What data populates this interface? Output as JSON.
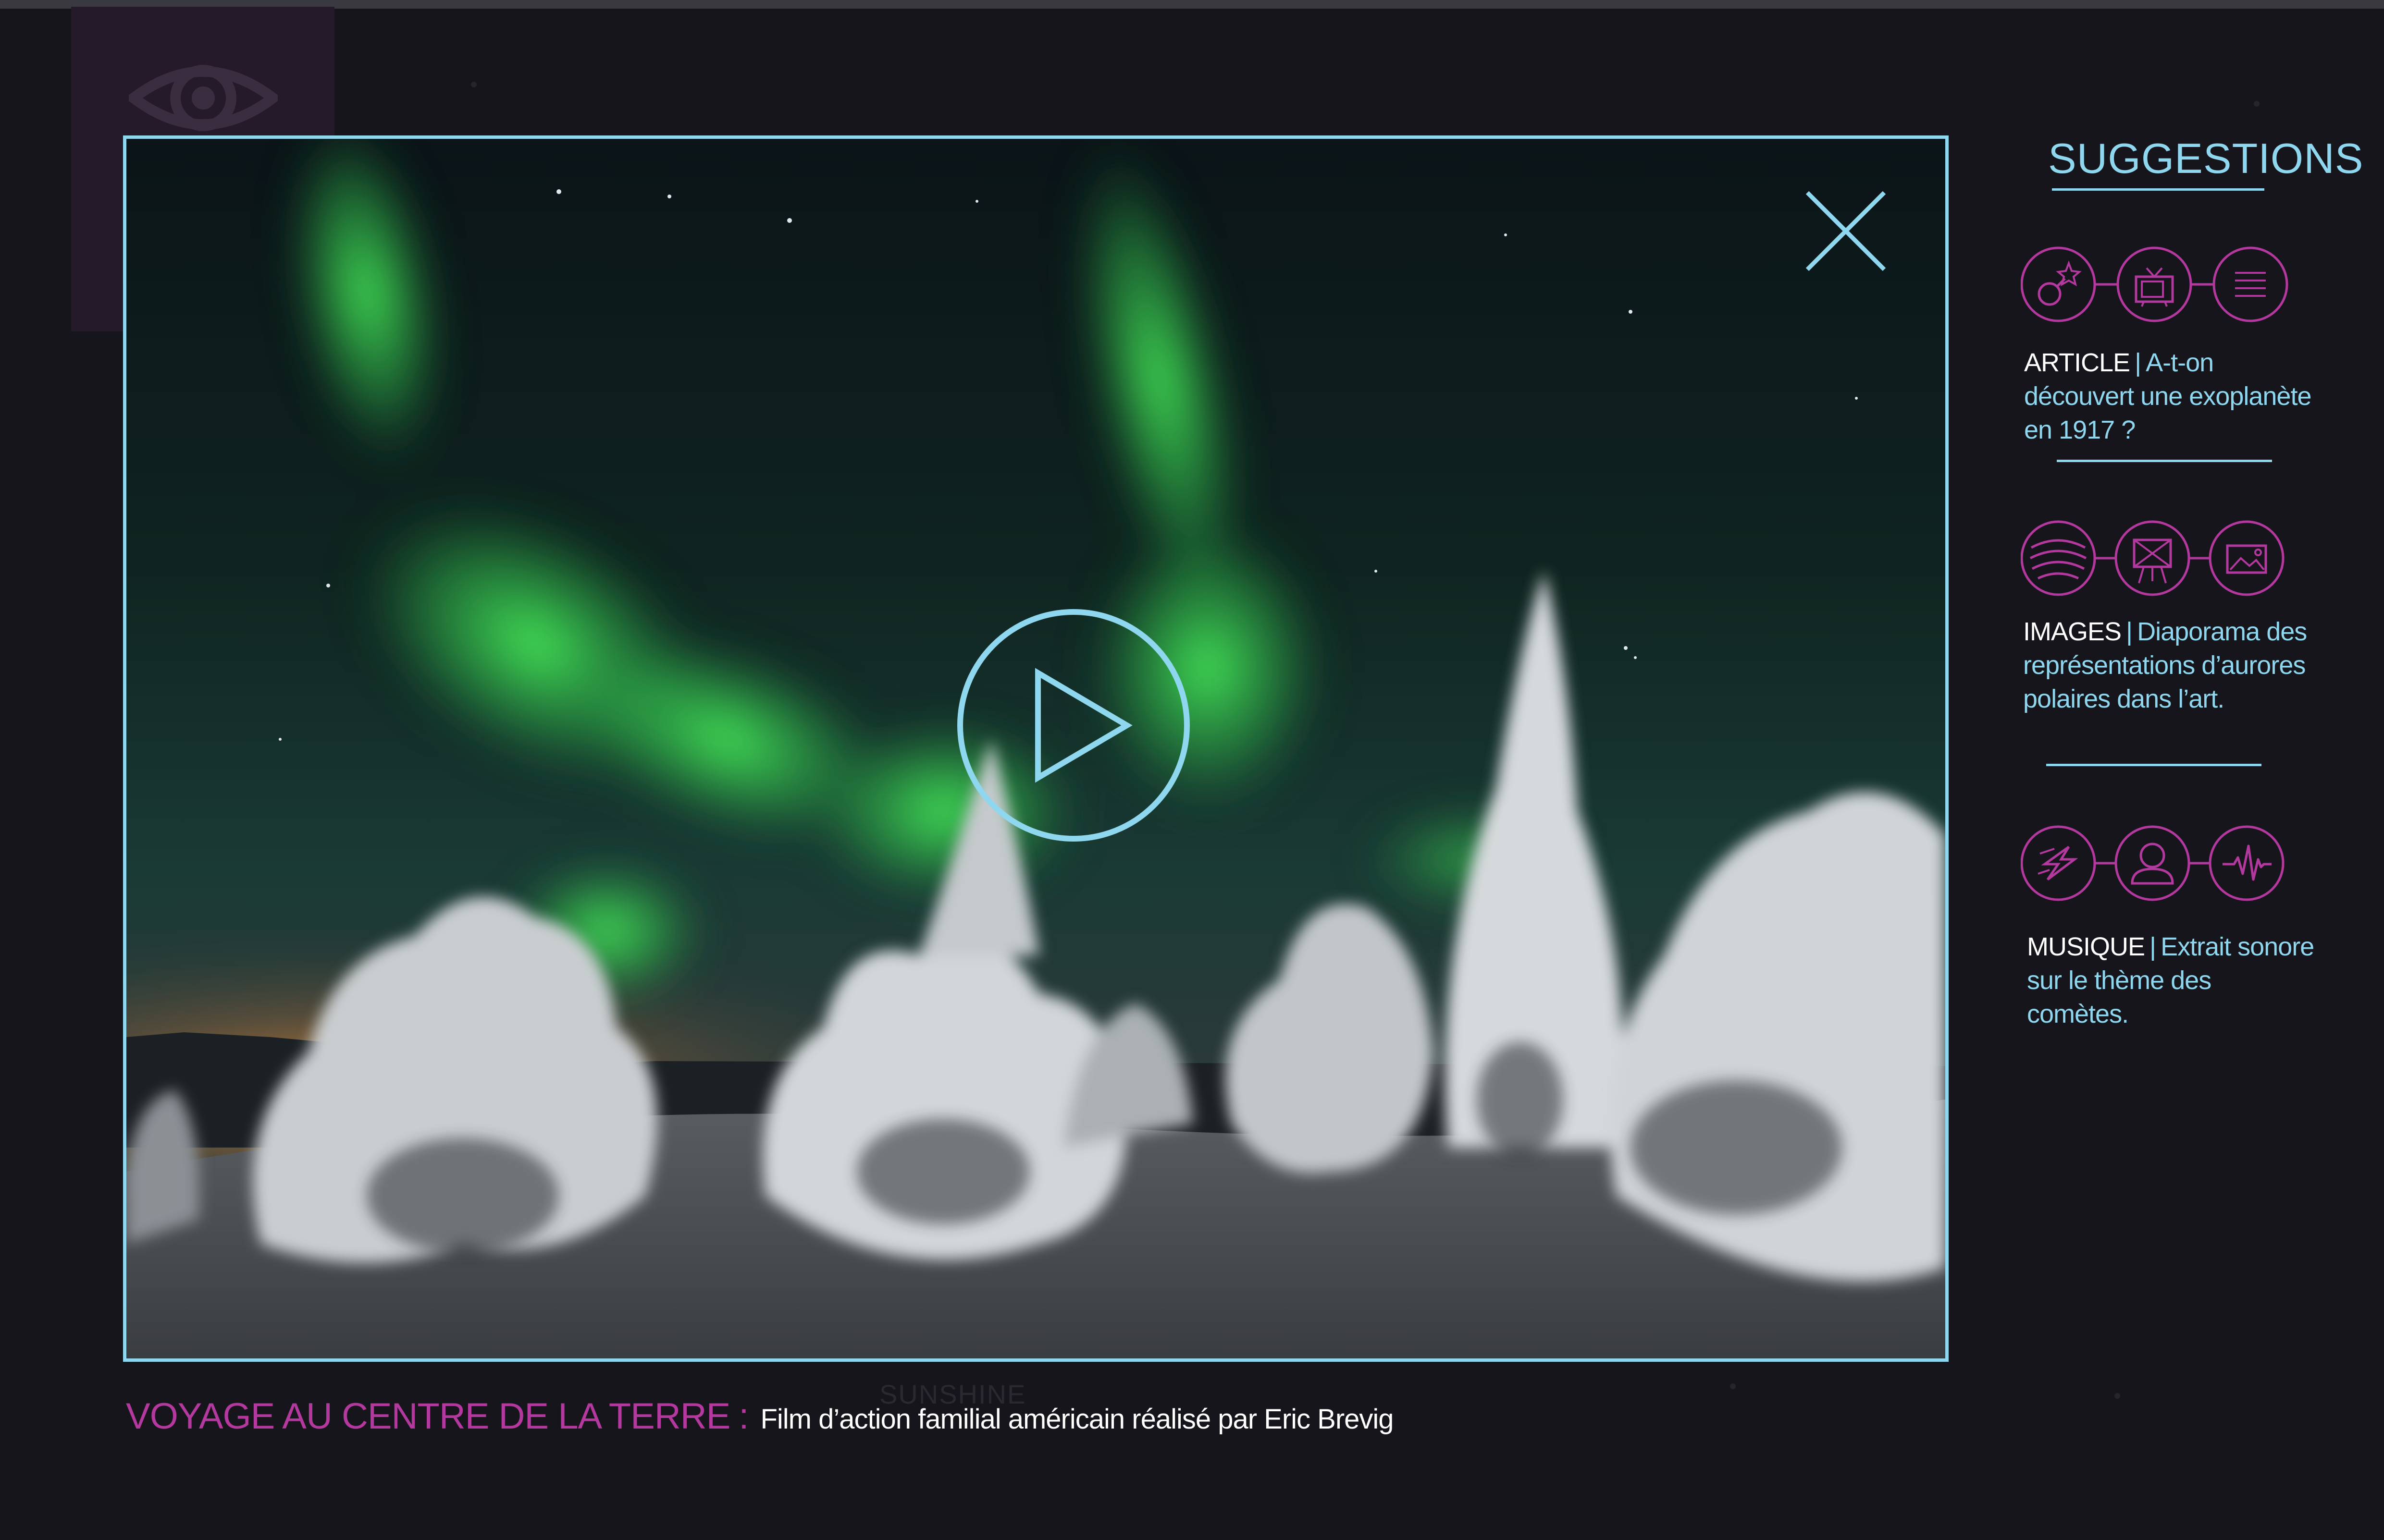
{
  "video": {
    "play_icon": "play-icon",
    "close_icon": "close-icon"
  },
  "caption": {
    "title": "VOYAGE AU CENTRE DE LA TERRE",
    "separator": ":",
    "description": "Film d’action familial américain réalisé par Eric Brevig"
  },
  "background": {
    "faint_text": "SUNSHINE"
  },
  "suggestions": {
    "title": "SUGGESTIONS",
    "items": [
      {
        "label": "ARTICLE",
        "separator": "|",
        "description": "A-t-on découvert une exoplanète en 1917 ?",
        "icons": [
          "planet-icon",
          "tv-icon",
          "text-lines-icon"
        ]
      },
      {
        "label": "IMAGES",
        "separator": "|",
        "description": "Diaporama des représentations d’aurores polaires dans l’art.",
        "icons": [
          "aurora-icon",
          "easel-icon",
          "picture-icon"
        ]
      },
      {
        "label": "MUSIQUE",
        "separator": "|",
        "description": "Extrait sonore sur le thème des comètes.",
        "icons": [
          "comet-icon",
          "user-icon",
          "waveform-icon"
        ]
      }
    ]
  },
  "colors": {
    "background": "#16151c",
    "accent_cyan": "#8fd6ef",
    "accent_magenta": "#b3399e",
    "text_white": "#ffffff"
  }
}
